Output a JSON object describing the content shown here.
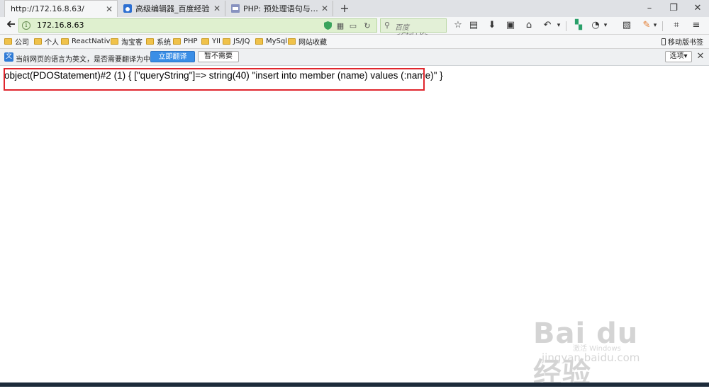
{
  "tabs": [
    {
      "title": "http://172.16.8.63/",
      "active": true
    },
    {
      "title": "高级编辑器_百度经验",
      "active": false
    },
    {
      "title": "PHP: 预处理语句与存储过程",
      "active": false
    }
  ],
  "new_tab_label": "+",
  "window_controls": {
    "minimize": "–",
    "restore": "❐",
    "close": "✕"
  },
  "address_bar": {
    "url": "172.16.8.63"
  },
  "search_bar": {
    "placeholder": "百度 <Ctrl+K>"
  },
  "bookmarks": [
    {
      "label": "公司"
    },
    {
      "label": "个人"
    },
    {
      "label": "ReactNative"
    },
    {
      "label": "淘宝客"
    },
    {
      "label": "系统"
    },
    {
      "label": "PHP"
    },
    {
      "label": "YII"
    },
    {
      "label": "JS/JQ"
    },
    {
      "label": "MySql"
    },
    {
      "label": "网站收藏"
    }
  ],
  "mobile_bookmarks": "移动版书签",
  "translate_bar": {
    "message": "当前网页的语言为英文，是否需要翻译为中文？",
    "translate_button": "立即翻译",
    "not_now_button": "暂不需要",
    "options_button": "选项▾",
    "close": "✕"
  },
  "page": {
    "output": "object(PDOStatement)#2 (1) { [\"queryString\"]=> string(40) \"insert into member (name) values (:name)\" }"
  },
  "watermark": {
    "logo": "Bai du 经验",
    "url": "jingyan.baidu.com",
    "activate": "激活 Windows"
  },
  "colors": {
    "highlight": "#e0262d",
    "urlbar": "#dff0cf",
    "translate_button": "#3a8ee6"
  }
}
